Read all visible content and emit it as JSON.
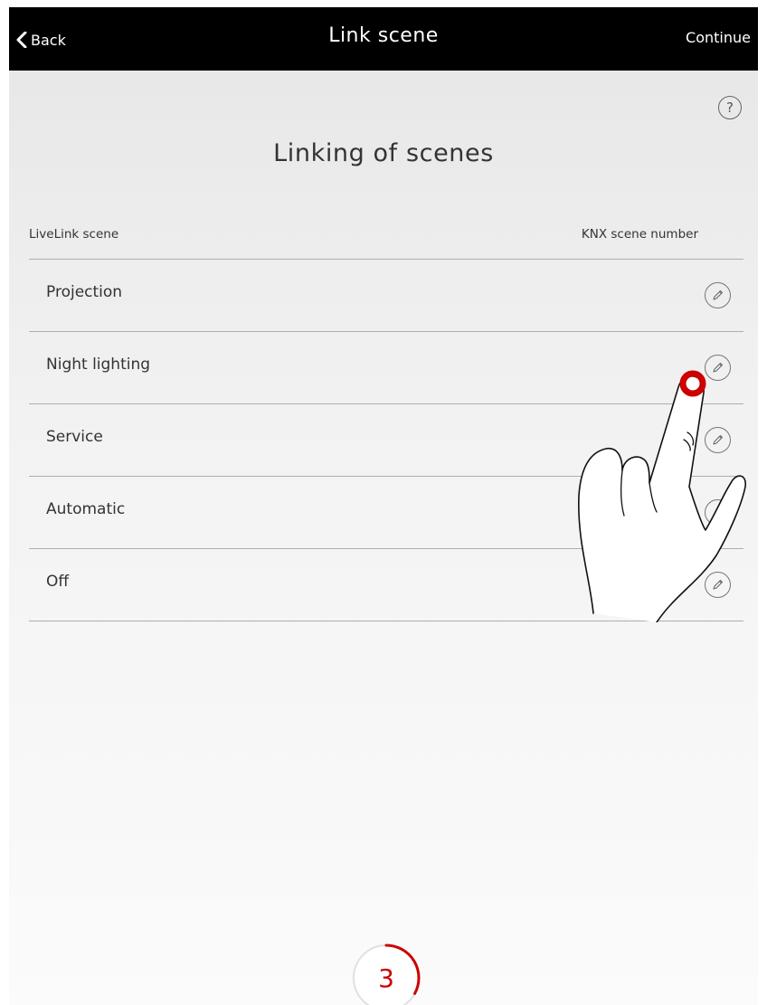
{
  "navbar": {
    "back_label": "Back",
    "title": "Link scene",
    "continue_label": "Continue"
  },
  "help": {
    "label": "?"
  },
  "page": {
    "title": "Linking of scenes"
  },
  "columns": {
    "left": "LiveLink scene",
    "right": "KNX scene number"
  },
  "scenes": [
    {
      "label": "Projection",
      "icon": "pencil-icon"
    },
    {
      "label": "Night lighting",
      "icon": "pencil-icon"
    },
    {
      "label": "Service",
      "icon": "pencil-icon"
    },
    {
      "label": "Automatic",
      "icon": "pencil-icon"
    },
    {
      "label": "Off",
      "icon": "pencil-icon"
    }
  ],
  "step": {
    "number": "3",
    "progress": 0.33
  },
  "colors": {
    "navbar": "#000000",
    "accent": "#cc0000",
    "text": "#333333",
    "divider": "#aeaeae"
  }
}
